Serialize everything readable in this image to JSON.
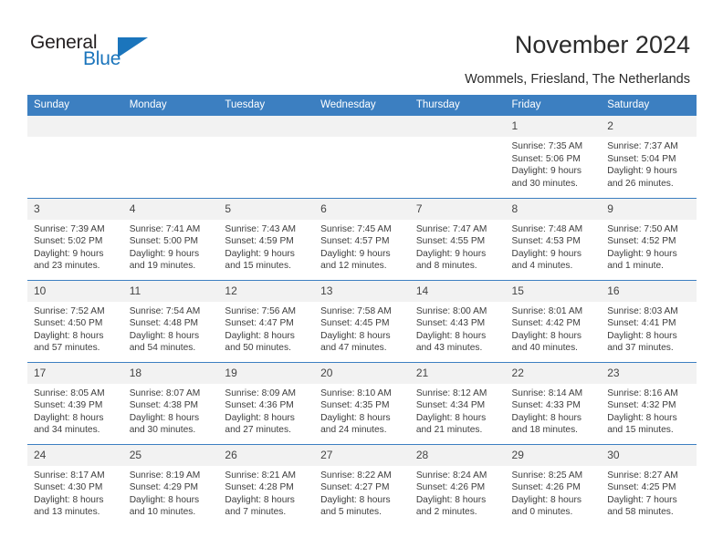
{
  "brand": {
    "name_part1": "General",
    "name_part2": "Blue",
    "triangle_color": "#1b75bc"
  },
  "header": {
    "title": "November 2024",
    "subtitle": "Wommels, Friesland, The Netherlands"
  },
  "theme": {
    "header_blue": "#3c7fc1",
    "daynum_band": "#f2f2f2",
    "text": "#3d3d3d"
  },
  "columns": [
    "Sunday",
    "Monday",
    "Tuesday",
    "Wednesday",
    "Thursday",
    "Friday",
    "Saturday"
  ],
  "weeks": [
    [
      {
        "day": "",
        "empty": true
      },
      {
        "day": "",
        "empty": true
      },
      {
        "day": "",
        "empty": true
      },
      {
        "day": "",
        "empty": true
      },
      {
        "day": "",
        "empty": true
      },
      {
        "day": "1",
        "sunrise": "Sunrise: 7:35 AM",
        "sunset": "Sunset: 5:06 PM",
        "daylight1": "Daylight: 9 hours",
        "daylight2": "and 30 minutes."
      },
      {
        "day": "2",
        "sunrise": "Sunrise: 7:37 AM",
        "sunset": "Sunset: 5:04 PM",
        "daylight1": "Daylight: 9 hours",
        "daylight2": "and 26 minutes."
      }
    ],
    [
      {
        "day": "3",
        "sunrise": "Sunrise: 7:39 AM",
        "sunset": "Sunset: 5:02 PM",
        "daylight1": "Daylight: 9 hours",
        "daylight2": "and 23 minutes."
      },
      {
        "day": "4",
        "sunrise": "Sunrise: 7:41 AM",
        "sunset": "Sunset: 5:00 PM",
        "daylight1": "Daylight: 9 hours",
        "daylight2": "and 19 minutes."
      },
      {
        "day": "5",
        "sunrise": "Sunrise: 7:43 AM",
        "sunset": "Sunset: 4:59 PM",
        "daylight1": "Daylight: 9 hours",
        "daylight2": "and 15 minutes."
      },
      {
        "day": "6",
        "sunrise": "Sunrise: 7:45 AM",
        "sunset": "Sunset: 4:57 PM",
        "daylight1": "Daylight: 9 hours",
        "daylight2": "and 12 minutes."
      },
      {
        "day": "7",
        "sunrise": "Sunrise: 7:47 AM",
        "sunset": "Sunset: 4:55 PM",
        "daylight1": "Daylight: 9 hours",
        "daylight2": "and 8 minutes."
      },
      {
        "day": "8",
        "sunrise": "Sunrise: 7:48 AM",
        "sunset": "Sunset: 4:53 PM",
        "daylight1": "Daylight: 9 hours",
        "daylight2": "and 4 minutes."
      },
      {
        "day": "9",
        "sunrise": "Sunrise: 7:50 AM",
        "sunset": "Sunset: 4:52 PM",
        "daylight1": "Daylight: 9 hours",
        "daylight2": "and 1 minute."
      }
    ],
    [
      {
        "day": "10",
        "sunrise": "Sunrise: 7:52 AM",
        "sunset": "Sunset: 4:50 PM",
        "daylight1": "Daylight: 8 hours",
        "daylight2": "and 57 minutes."
      },
      {
        "day": "11",
        "sunrise": "Sunrise: 7:54 AM",
        "sunset": "Sunset: 4:48 PM",
        "daylight1": "Daylight: 8 hours",
        "daylight2": "and 54 minutes."
      },
      {
        "day": "12",
        "sunrise": "Sunrise: 7:56 AM",
        "sunset": "Sunset: 4:47 PM",
        "daylight1": "Daylight: 8 hours",
        "daylight2": "and 50 minutes."
      },
      {
        "day": "13",
        "sunrise": "Sunrise: 7:58 AM",
        "sunset": "Sunset: 4:45 PM",
        "daylight1": "Daylight: 8 hours",
        "daylight2": "and 47 minutes."
      },
      {
        "day": "14",
        "sunrise": "Sunrise: 8:00 AM",
        "sunset": "Sunset: 4:43 PM",
        "daylight1": "Daylight: 8 hours",
        "daylight2": "and 43 minutes."
      },
      {
        "day": "15",
        "sunrise": "Sunrise: 8:01 AM",
        "sunset": "Sunset: 4:42 PM",
        "daylight1": "Daylight: 8 hours",
        "daylight2": "and 40 minutes."
      },
      {
        "day": "16",
        "sunrise": "Sunrise: 8:03 AM",
        "sunset": "Sunset: 4:41 PM",
        "daylight1": "Daylight: 8 hours",
        "daylight2": "and 37 minutes."
      }
    ],
    [
      {
        "day": "17",
        "sunrise": "Sunrise: 8:05 AM",
        "sunset": "Sunset: 4:39 PM",
        "daylight1": "Daylight: 8 hours",
        "daylight2": "and 34 minutes."
      },
      {
        "day": "18",
        "sunrise": "Sunrise: 8:07 AM",
        "sunset": "Sunset: 4:38 PM",
        "daylight1": "Daylight: 8 hours",
        "daylight2": "and 30 minutes."
      },
      {
        "day": "19",
        "sunrise": "Sunrise: 8:09 AM",
        "sunset": "Sunset: 4:36 PM",
        "daylight1": "Daylight: 8 hours",
        "daylight2": "and 27 minutes."
      },
      {
        "day": "20",
        "sunrise": "Sunrise: 8:10 AM",
        "sunset": "Sunset: 4:35 PM",
        "daylight1": "Daylight: 8 hours",
        "daylight2": "and 24 minutes."
      },
      {
        "day": "21",
        "sunrise": "Sunrise: 8:12 AM",
        "sunset": "Sunset: 4:34 PM",
        "daylight1": "Daylight: 8 hours",
        "daylight2": "and 21 minutes."
      },
      {
        "day": "22",
        "sunrise": "Sunrise: 8:14 AM",
        "sunset": "Sunset: 4:33 PM",
        "daylight1": "Daylight: 8 hours",
        "daylight2": "and 18 minutes."
      },
      {
        "day": "23",
        "sunrise": "Sunrise: 8:16 AM",
        "sunset": "Sunset: 4:32 PM",
        "daylight1": "Daylight: 8 hours",
        "daylight2": "and 15 minutes."
      }
    ],
    [
      {
        "day": "24",
        "sunrise": "Sunrise: 8:17 AM",
        "sunset": "Sunset: 4:30 PM",
        "daylight1": "Daylight: 8 hours",
        "daylight2": "and 13 minutes."
      },
      {
        "day": "25",
        "sunrise": "Sunrise: 8:19 AM",
        "sunset": "Sunset: 4:29 PM",
        "daylight1": "Daylight: 8 hours",
        "daylight2": "and 10 minutes."
      },
      {
        "day": "26",
        "sunrise": "Sunrise: 8:21 AM",
        "sunset": "Sunset: 4:28 PM",
        "daylight1": "Daylight: 8 hours",
        "daylight2": "and 7 minutes."
      },
      {
        "day": "27",
        "sunrise": "Sunrise: 8:22 AM",
        "sunset": "Sunset: 4:27 PM",
        "daylight1": "Daylight: 8 hours",
        "daylight2": "and 5 minutes."
      },
      {
        "day": "28",
        "sunrise": "Sunrise: 8:24 AM",
        "sunset": "Sunset: 4:26 PM",
        "daylight1": "Daylight: 8 hours",
        "daylight2": "and 2 minutes."
      },
      {
        "day": "29",
        "sunrise": "Sunrise: 8:25 AM",
        "sunset": "Sunset: 4:26 PM",
        "daylight1": "Daylight: 8 hours",
        "daylight2": "and 0 minutes."
      },
      {
        "day": "30",
        "sunrise": "Sunrise: 8:27 AM",
        "sunset": "Sunset: 4:25 PM",
        "daylight1": "Daylight: 7 hours",
        "daylight2": "and 58 minutes."
      }
    ]
  ]
}
